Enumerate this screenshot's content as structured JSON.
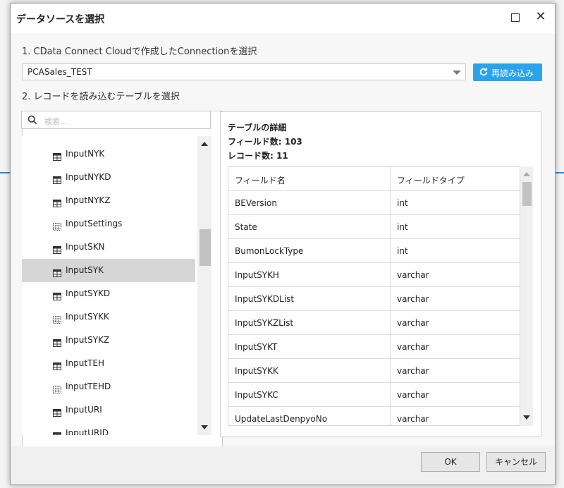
{
  "dialog": {
    "title": "データソースを選択",
    "step1_label": "1. CData Connect Cloudで作成したConnectionを選択",
    "connection_value": "PCASales_TEST",
    "reload_label": "再読み込み",
    "step2_label": "2. レコードを読み込むテーブルを選択",
    "search_placeholder": "検索..."
  },
  "tables": [
    {
      "label": "InputNYK",
      "icon": "table-icon",
      "selected": false
    },
    {
      "label": "InputNYKD",
      "icon": "table-icon",
      "selected": false
    },
    {
      "label": "InputNYKZ",
      "icon": "table-icon",
      "selected": false
    },
    {
      "label": "InputSettings",
      "icon": "view-icon",
      "selected": false
    },
    {
      "label": "InputSKN",
      "icon": "table-icon",
      "selected": false
    },
    {
      "label": "InputSYK",
      "icon": "table-icon",
      "selected": true
    },
    {
      "label": "InputSYKD",
      "icon": "table-icon",
      "selected": false
    },
    {
      "label": "InputSYKK",
      "icon": "view-icon",
      "selected": false
    },
    {
      "label": "InputSYKZ",
      "icon": "table-icon",
      "selected": false
    },
    {
      "label": "InputTEH",
      "icon": "table-icon",
      "selected": false
    },
    {
      "label": "InputTEHD",
      "icon": "view-icon",
      "selected": false
    },
    {
      "label": "InputURI",
      "icon": "table-icon",
      "selected": false
    },
    {
      "label": "InputURID",
      "icon": "table-icon",
      "selected": false
    }
  ],
  "details": {
    "heading": "テーブルの詳細",
    "field_count": "フィールド数: 103",
    "record_count": "レコード数: 11",
    "columns": [
      "フィールド名",
      "フィールドタイプ"
    ],
    "rows": [
      [
        "BEVersion",
        "int"
      ],
      [
        "State",
        "int"
      ],
      [
        "BumonLockType",
        "int"
      ],
      [
        "InputSYKH",
        "varchar"
      ],
      [
        "InputSYKDList",
        "varchar"
      ],
      [
        "InputSYKZList",
        "varchar"
      ],
      [
        "InputSYKT",
        "varchar"
      ],
      [
        "InputSYKK",
        "varchar"
      ],
      [
        "InputSYKC",
        "varchar"
      ],
      [
        "UpdateLastDenpyoNo",
        "varchar"
      ]
    ]
  },
  "footer": {
    "ok_label": "OK",
    "cancel_label": "キャンセル"
  },
  "colors": {
    "accent": "#2aa3ee",
    "selected_row": "#d6d6d6"
  }
}
